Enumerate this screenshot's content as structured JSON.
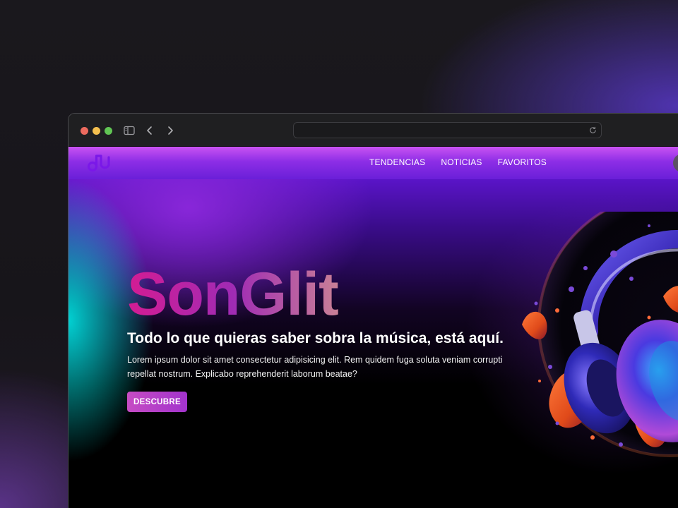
{
  "browser": {
    "url": "",
    "icons": [
      "sidebar-icon",
      "back-icon",
      "forward-icon",
      "reload-icon"
    ]
  },
  "site": {
    "logo": "music-note-logo",
    "nav": [
      {
        "label": "TENDENCIAS"
      },
      {
        "label": "NOTICIAS"
      },
      {
        "label": "FAVORITOS"
      }
    ]
  },
  "hero": {
    "title": "SonGlit",
    "subtitle": "Todo lo que quieras saber sobra la música, está aquí.",
    "body": "Lorem ipsum dolor sit amet consectetur adipisicing elit. Rem quidem fuga soluta veniam corrupti repellat nostrum. Explicabo reprehenderit laborum beatae?",
    "cta_label": "DESCUBRE",
    "image": "headphones-illustration"
  },
  "colors": {
    "accent": "#a233cc",
    "header_gradient_start": "#c953f2",
    "header_gradient_end": "#6a1fd8",
    "title_pink": "#d41c93",
    "background": "#17151a"
  }
}
